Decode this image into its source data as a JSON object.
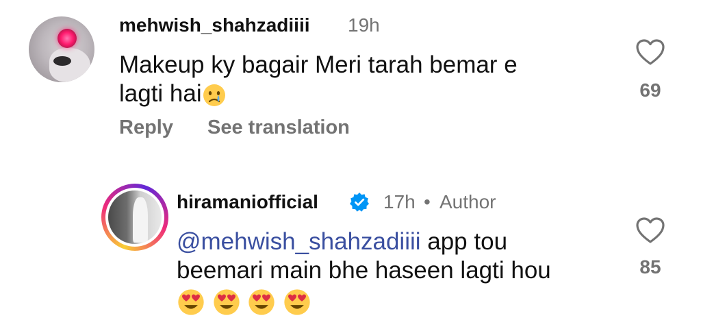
{
  "comments": [
    {
      "username": "mehwish_shahzadiiii",
      "time": "19h",
      "text_line1": "Makeup ky bagair Meri tarah bemar e",
      "text_line2": "lagti hai",
      "emoji": "crying-face",
      "like_count": "69",
      "reply_label": "Reply",
      "translate_label": "See translation"
    },
    {
      "username": "hiramaniofficial",
      "verified": true,
      "time": "17h",
      "separator": "•",
      "author_label": "Author",
      "mention": "@mehwish_shahzadiiii",
      "text_line1_rest": " app tou",
      "text_line2": "beemari main bhe haseen lagti hou",
      "emoji": "heart-eyes-face",
      "emoji_count": 4,
      "like_count": "85"
    }
  ],
  "colors": {
    "mention": "#3a4fa0",
    "secondary_text": "#737373",
    "verified_blue": "#0095f6"
  }
}
